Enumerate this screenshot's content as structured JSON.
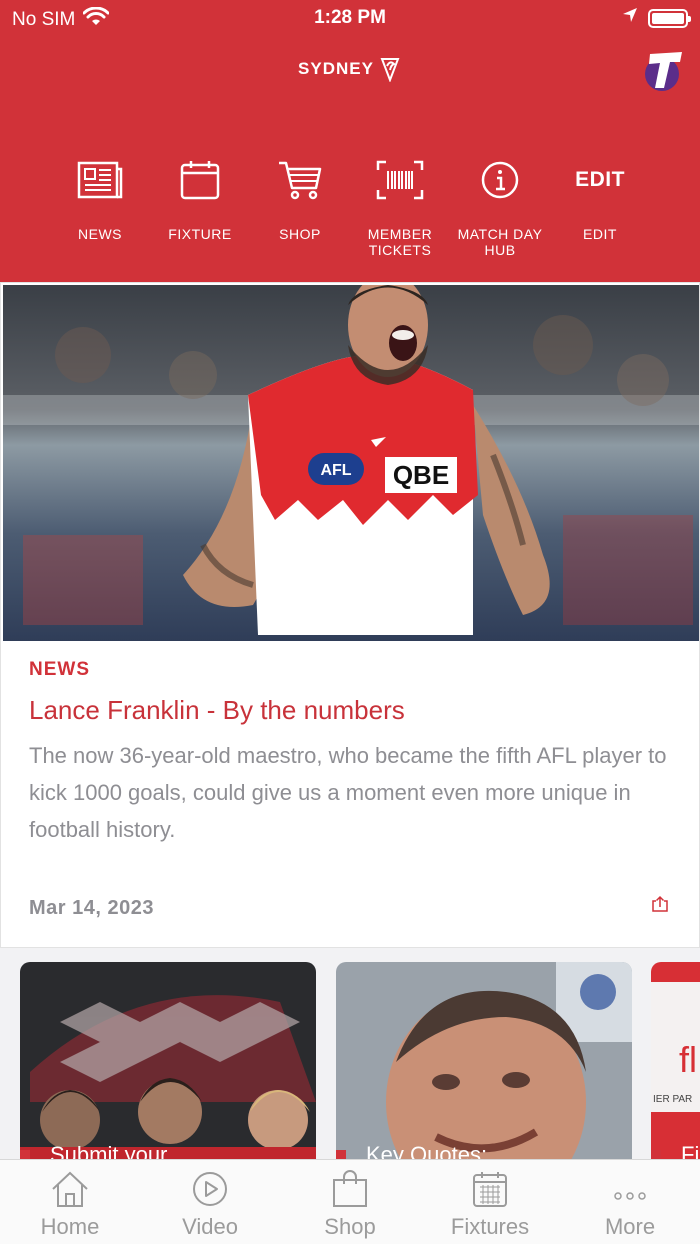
{
  "status_bar": {
    "carrier": "No SIM",
    "time": "1:28 PM"
  },
  "header": {
    "logo_text": "SYDNEY"
  },
  "shortcuts": [
    {
      "label": "NEWS"
    },
    {
      "label": "FIXTURE"
    },
    {
      "label": "SHOP"
    },
    {
      "label": "MEMBER TICKETS"
    },
    {
      "label": "MATCH DAY HUB"
    },
    {
      "label": "EDIT",
      "icon_text": "EDIT"
    }
  ],
  "hero": {
    "tag": "NEWS",
    "title": "Lance Franklin - By the numbers",
    "summary": "The now 36-year-old maestro, who became the fifth AFL player to kick 1000 goals, could give us a moment even more unique in football history.",
    "date": "Mar 14, 2023",
    "jersey_logos": [
      "AFL",
      "QBE"
    ]
  },
  "carousel": [
    {
      "title": "Submit your"
    },
    {
      "title": "Key Quotes:"
    },
    {
      "title": "Fi"
    }
  ],
  "tabbar": [
    {
      "label": "Home"
    },
    {
      "label": "Video"
    },
    {
      "label": "Shop"
    },
    {
      "label": "Fixtures"
    },
    {
      "label": "More"
    }
  ],
  "colors": {
    "brand_red": "#d13239",
    "muted_text": "#8e8e93",
    "tab_inactive": "#9b9b9b"
  }
}
